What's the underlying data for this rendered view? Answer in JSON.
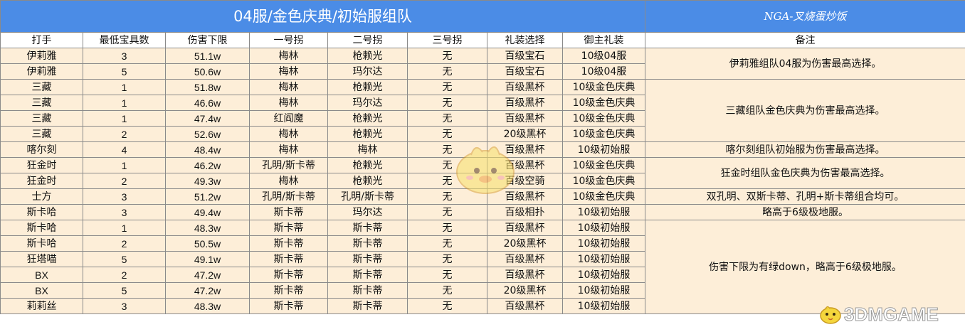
{
  "title": "04服/金色庆典/初始服组队",
  "signature": "NGA-叉烧蛋炒饭",
  "headers": [
    "打手",
    "最低宝具数",
    "伤害下限",
    "一号拐",
    "二号拐",
    "三号拐",
    "礼装选择",
    "御主礼装",
    "备注"
  ],
  "rows": [
    [
      "伊莉雅",
      "3",
      "51.1w",
      "梅林",
      "枪赖光",
      "无",
      "百级宝石",
      "10级04服"
    ],
    [
      "伊莉雅",
      "5",
      "50.6w",
      "梅林",
      "玛尔达",
      "无",
      "百级宝石",
      "10级04服"
    ],
    [
      "三藏",
      "1",
      "51.8w",
      "梅林",
      "枪赖光",
      "无",
      "百级黑杯",
      "10级金色庆典"
    ],
    [
      "三藏",
      "1",
      "46.6w",
      "梅林",
      "玛尔达",
      "无",
      "百级黑杯",
      "10级金色庆典"
    ],
    [
      "三藏",
      "1",
      "47.4w",
      "红阎魔",
      "枪赖光",
      "无",
      "百级黑杯",
      "10级金色庆典"
    ],
    [
      "三藏",
      "2",
      "52.6w",
      "梅林",
      "枪赖光",
      "无",
      "20级黑杯",
      "10级金色庆典"
    ],
    [
      "喀尔刻",
      "4",
      "48.4w",
      "梅林",
      "梅林",
      "无",
      "百级黑杯",
      "10级初始服"
    ],
    [
      "狂金时",
      "1",
      "46.2w",
      "孔明/斯卡蒂",
      "枪赖光",
      "无",
      "百级黑杯",
      "10级金色庆典"
    ],
    [
      "狂金时",
      "2",
      "49.3w",
      "梅林",
      "枪赖光",
      "无",
      "百级空骑",
      "10级金色庆典"
    ],
    [
      "士方",
      "3",
      "51.2w",
      "孔明/斯卡蒂",
      "孔明/斯卡蒂",
      "无",
      "百级黑杯",
      "10级金色庆典"
    ],
    [
      "斯卡哈",
      "3",
      "49.4w",
      "斯卡蒂",
      "玛尔达",
      "无",
      "百级相扑",
      "10级初始服"
    ],
    [
      "斯卡哈",
      "1",
      "48.3w",
      "斯卡蒂",
      "斯卡蒂",
      "无",
      "百级黑杯",
      "10级初始服"
    ],
    [
      "斯卡哈",
      "2",
      "50.5w",
      "斯卡蒂",
      "斯卡蒂",
      "无",
      "20级黑杯",
      "10级初始服"
    ],
    [
      "狂塔喵",
      "5",
      "49.1w",
      "斯卡蒂",
      "斯卡蒂",
      "无",
      "百级黑杯",
      "10级初始服"
    ],
    [
      "BX",
      "2",
      "47.2w",
      "斯卡蒂",
      "斯卡蒂",
      "无",
      "百级黑杯",
      "10级初始服"
    ],
    [
      "BX",
      "5",
      "47.2w",
      "斯卡蒂",
      "斯卡蒂",
      "无",
      "20级黑杯",
      "10级初始服"
    ],
    [
      "莉莉丝",
      "3",
      "48.3w",
      "斯卡蒂",
      "斯卡蒂",
      "无",
      "百级黑杯",
      "10级初始服"
    ]
  ],
  "notes": [
    "伊莉雅组队04服为伤害最高选择。",
    "三藏组队金色庆典为伤害最高选择。",
    "喀尔刻组队初始服为伤害最高选择。",
    "狂金时组队金色庆典为伤害最高选择。",
    "双孔明、双斯卡蒂、孔明+斯卡蒂组合均可。",
    "略高于6级极地服。",
    "伤害下限为有绿down，略高于6级极地服。"
  ],
  "watermark": "3DMGAME",
  "colors": {
    "title_bg": "#4b8ce6",
    "row_bg": "#fdeed8",
    "highlight_text": "#e02020"
  }
}
